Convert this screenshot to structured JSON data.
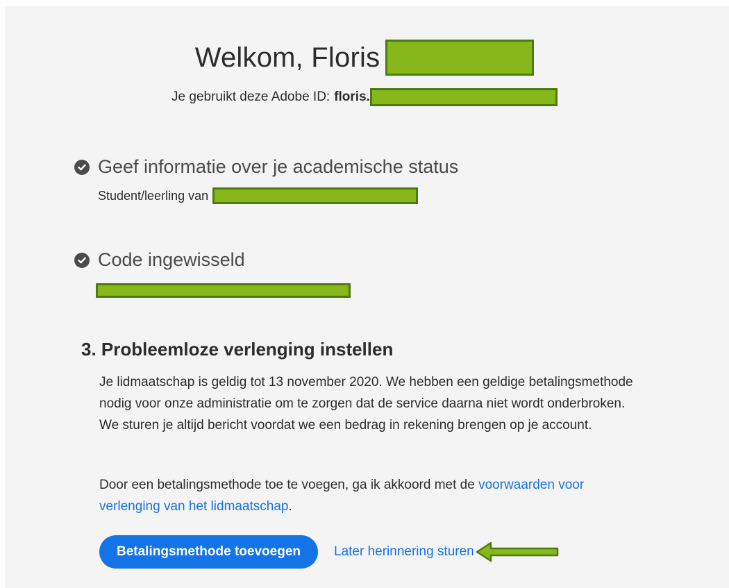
{
  "header": {
    "welcome": "Welkom, Floris",
    "adobe_id_label": "Je gebruikt deze Adobe ID:",
    "adobe_id_value": "floris."
  },
  "steps": {
    "academic": {
      "title": "Geef informatie over je academische status",
      "detail_label": "Student/leerling van"
    },
    "code": {
      "title": "Code ingewisseld"
    },
    "renewal": {
      "title": "3. Probleemloze verlenging instellen",
      "paragraph1": "Je lidmaatschap is geldig tot 13 november 2020. We hebben een geldige betalingsmethode nodig voor onze administratie om te zorgen dat de service daarna niet wordt onderbroken. We sturen je altijd bericht voordat we een bedrag in rekening brengen op je account.",
      "paragraph2_prefix": "Door een betalingsmethode toe te voegen, ga ik akkoord met de ",
      "paragraph2_link": "voorwaarden voor verlenging van het lidmaatschap",
      "paragraph2_suffix": "."
    }
  },
  "actions": {
    "add_payment": "Betalingsmethode toevoegen",
    "remind_later": "Later herinnering sturen"
  },
  "colors": {
    "accent": "#1473e6",
    "redaction": "#86b81b",
    "check": "#4b4b4b"
  },
  "icons": {
    "step_done": "checkmark-circle-icon",
    "annotation": "arrow-left-icon"
  }
}
